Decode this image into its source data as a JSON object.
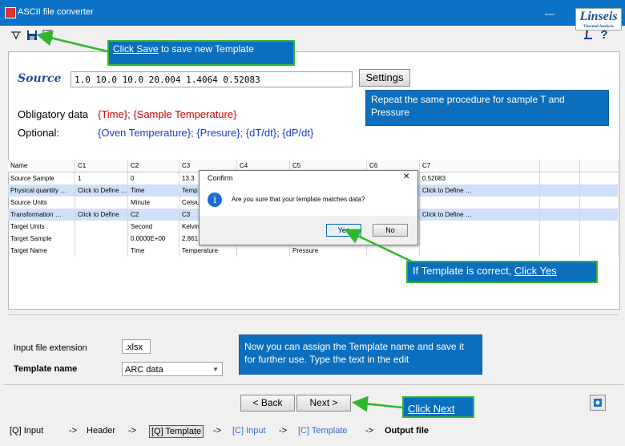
{
  "window": {
    "title": "ASCII file converter",
    "minimize_glyph": "—",
    "logo_text": "Linseis",
    "logo_sub": "Thermal Analysis"
  },
  "toolbar": {
    "icons": [
      "new-icon",
      "save-icon",
      "preview-icon"
    ],
    "right_icons": [
      "export-icon",
      "help-icon"
    ],
    "help_label": "?"
  },
  "source": {
    "label": "Source",
    "value": "1.0 10.0 10.0 20.004 1.4064 0.52083",
    "settings_button": "Settings"
  },
  "data_labels": {
    "obligatory_label": "Obligatory data",
    "obligatory_value": "{Time}; {Sample Temperature}",
    "optional_label": "Optional:",
    "optional_value": "{Oven Temperature}; {Presure}; {dT/dt}; {dP/dt}"
  },
  "grid": {
    "headers": [
      "Name",
      "C1",
      "C2",
      "C3",
      "C4",
      "C5",
      "C6",
      "C7",
      "",
      ""
    ],
    "rows": [
      {
        "cells": [
          "Source Sample",
          "1",
          "0",
          "13.3",
          "",
          "",
          "",
          "0.52083",
          "",
          ""
        ],
        "highlight": false
      },
      {
        "cells": [
          "Physical quantity …",
          "Click to Define …",
          "Time",
          "Temp",
          "",
          "",
          "",
          "Click to Define …",
          "",
          ""
        ],
        "highlight": true
      },
      {
        "cells": [
          "Source Units",
          "",
          "Minute",
          "Celsius",
          "",
          "",
          "",
          "",
          "",
          ""
        ],
        "highlight": false
      },
      {
        "cells": [
          "Transformation …",
          "Click to Define",
          "C2",
          "C3",
          "",
          "",
          "",
          "Click to Define …",
          "",
          ""
        ],
        "highlight": true
      },
      {
        "cells": [
          "Target Units",
          "",
          "Second",
          "Kelvin",
          "",
          "",
          "",
          "",
          "",
          ""
        ],
        "highlight": false
      },
      {
        "cells": [
          "Target Sample",
          "",
          "0.0000E+00",
          "2.861",
          "",
          "",
          "",
          "",
          "",
          ""
        ],
        "highlight": false
      },
      {
        "cells": [
          "Target Name",
          "",
          "Time",
          "Temperature",
          "",
          "Pressure",
          "",
          "",
          "",
          ""
        ],
        "highlight": false
      }
    ]
  },
  "dialog": {
    "title": "Confirm",
    "message": "Are you sure that your template matches data?",
    "info_glyph": "i",
    "yes": "Yes",
    "no": "No",
    "close_glyph": "✕"
  },
  "form": {
    "ext_label": "Input file extension",
    "ext_value": ".xlsx",
    "template_label": "Template name",
    "template_value": "ARC data"
  },
  "nav": {
    "back": "< Back",
    "next": "Next >"
  },
  "tabs": [
    {
      "label": "[Q] Input",
      "active": false,
      "faded": false
    },
    {
      "label": "->",
      "active": false,
      "faded": false
    },
    {
      "label": "Header",
      "active": false,
      "faded": false
    },
    {
      "label": "->",
      "active": false,
      "faded": false
    },
    {
      "label": "[Q] Template",
      "active": true,
      "faded": false
    },
    {
      "label": "->",
      "active": false,
      "faded": false
    },
    {
      "label": "[C] Input",
      "active": false,
      "faded": true
    },
    {
      "label": "->",
      "active": false,
      "faded": false
    },
    {
      "label": "[C] Template",
      "active": false,
      "faded": true
    },
    {
      "label": "->",
      "active": false,
      "faded": false
    },
    {
      "label": "Output file",
      "active": false,
      "faded": false
    }
  ],
  "callouts": {
    "save_link": "Click Save",
    "save_rest": " to save new Template",
    "repeat": "Repeat the same procedure for sample T and Pressure",
    "correct_prefix": "If Template is correct, ",
    "correct_link": "Click Yes",
    "assign": "Now you can assign the Template name and save it for further use. Type the text in the edit",
    "next": "Click Next"
  },
  "colors": {
    "accent": "#0b72c6",
    "callout": "#0b6fbe",
    "arrow": "#2eb82e",
    "highlight_row": "#cfe0f8",
    "obligatory": "#d00000",
    "optional": "#1a3cc8"
  }
}
